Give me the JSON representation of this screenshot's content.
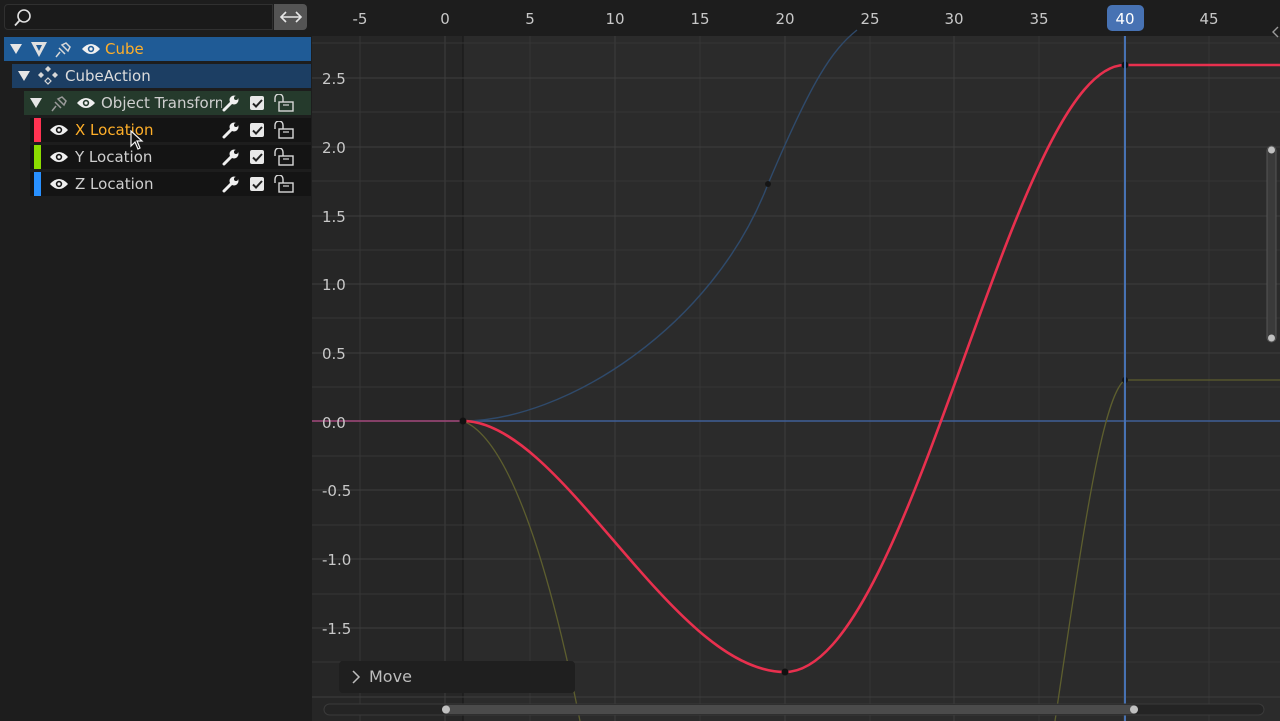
{
  "sidebar": {
    "search": {
      "placeholder": ""
    },
    "rows": [
      {
        "label": "Cube",
        "kind": "object"
      },
      {
        "label": "CubeAction",
        "kind": "action"
      },
      {
        "label": "Object Transforms",
        "kind": "group"
      },
      {
        "label": "X Location",
        "kind": "channel",
        "color": "#ff3352"
      },
      {
        "label": "Y Location",
        "kind": "channel",
        "color": "#8bdc00"
      },
      {
        "label": "Z Location",
        "kind": "channel",
        "color": "#2890ff"
      }
    ]
  },
  "graph": {
    "frame_ticks": [
      "-5",
      "0",
      "5",
      "10",
      "15",
      "20",
      "25",
      "30",
      "35",
      "45"
    ],
    "value_ticks": [
      "2.5",
      "2.0",
      "1.5",
      "1.0",
      "0.5",
      "0.0",
      "-0.5",
      "-1.0",
      "-1.5"
    ],
    "current_frame": "40"
  },
  "operator_panel": {
    "label": "Move"
  },
  "colors": {
    "x_curve": "#e8304e",
    "y_curve": "#5d5e2e",
    "z_curve": "#2f4a6b",
    "playhead": "#4772b3",
    "selected_text": "#ffaf29"
  }
}
